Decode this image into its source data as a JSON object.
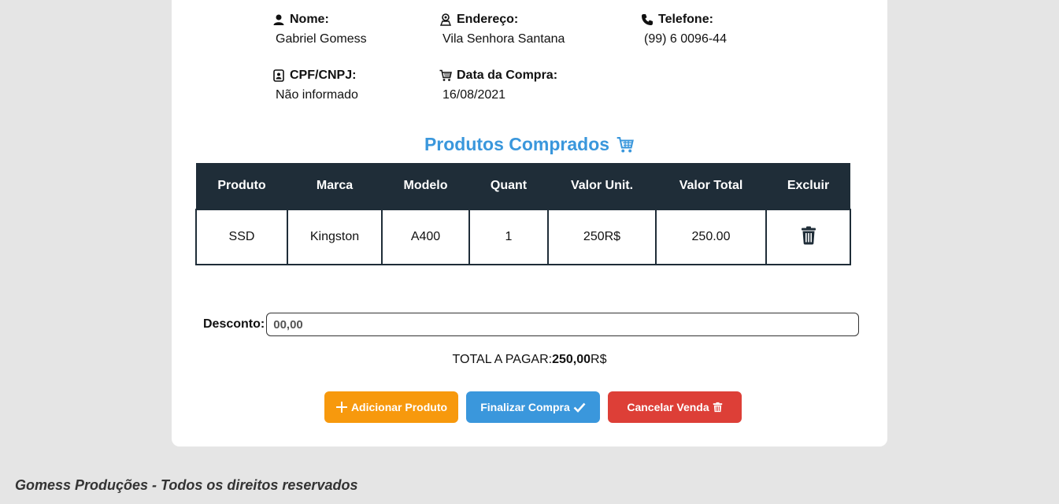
{
  "customer": {
    "name": {
      "label": "Nome:",
      "value": "Gabriel Gomess",
      "icon": "user-icon"
    },
    "address": {
      "label": "Endereço:",
      "value": "Vila Senhora Santana",
      "icon": "location-user-icon"
    },
    "phone": {
      "label": "Telefone:",
      "value": "(99) 6 0096-44",
      "icon": "phone-icon"
    },
    "doc": {
      "label": "CPF/CNPJ:",
      "value": "Não informado",
      "icon": "id-card-icon"
    },
    "date": {
      "label": "Data da Compra:",
      "value": "16/08/2021",
      "icon": "cart-icon"
    }
  },
  "products_title": "Produtos Comprados",
  "table": {
    "headers": [
      "Produto",
      "Marca",
      "Modelo",
      "Quant",
      "Valor Unit.",
      "Valor Total",
      "Excluir"
    ],
    "rows": [
      {
        "produto": "SSD",
        "marca": "Kingston",
        "modelo": "A400",
        "quant": "1",
        "valor_unit": "250R$",
        "valor_total": "250.00",
        "excluir_icon": "trash-icon"
      }
    ]
  },
  "discount": {
    "label": "Desconto:",
    "value": "00,00"
  },
  "total": {
    "label": "TOTAL A PAGAR:",
    "value": "250,00",
    "currency": "R$"
  },
  "buttons": {
    "add": "Adicionar Produto",
    "finish": "Finalizar Compra",
    "cancel": "Cancelar Venda"
  },
  "colors": {
    "accent_blue": "#3a97dc",
    "orange": "#f7990d",
    "red": "#dd3f37",
    "table_header": "#1f2d38"
  },
  "footer": "Gomess Produções - Todos os direitos reservados"
}
